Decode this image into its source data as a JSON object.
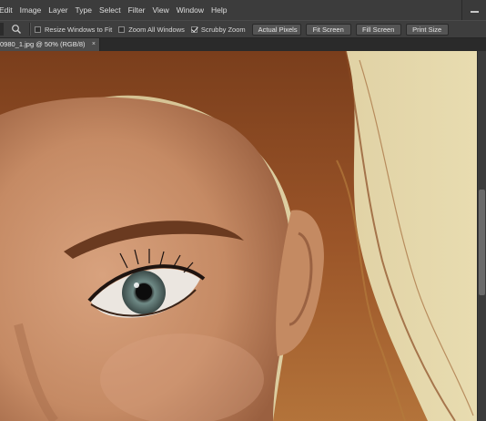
{
  "menu": {
    "items": [
      "Edit",
      "Image",
      "Layer",
      "Type",
      "Select",
      "Filter",
      "View",
      "Window",
      "Help"
    ]
  },
  "options": {
    "tool_icon": "zoom-icon",
    "resize_windows": {
      "label": "Resize Windows to Fit",
      "checked": false
    },
    "zoom_all": {
      "label": "Zoom All Windows",
      "checked": false
    },
    "scrubby_zoom": {
      "label": "Scrubby Zoom",
      "checked": true
    },
    "buttons": {
      "actual_pixels": "Actual Pixels",
      "fit_screen": "Fit Screen",
      "fill_screen": "Fill Screen",
      "print_size": "Print Size"
    }
  },
  "document": {
    "tab_label": "0980_1.jpg @ 50% (RGB/8)",
    "close_glyph": "×"
  },
  "colors": {
    "menubar": "#3c3c3c",
    "optionsbar": "#3e3e3e",
    "background_wall": "#ddd0a0",
    "skin": "#c98f6a",
    "hair": "#8a4a22"
  }
}
